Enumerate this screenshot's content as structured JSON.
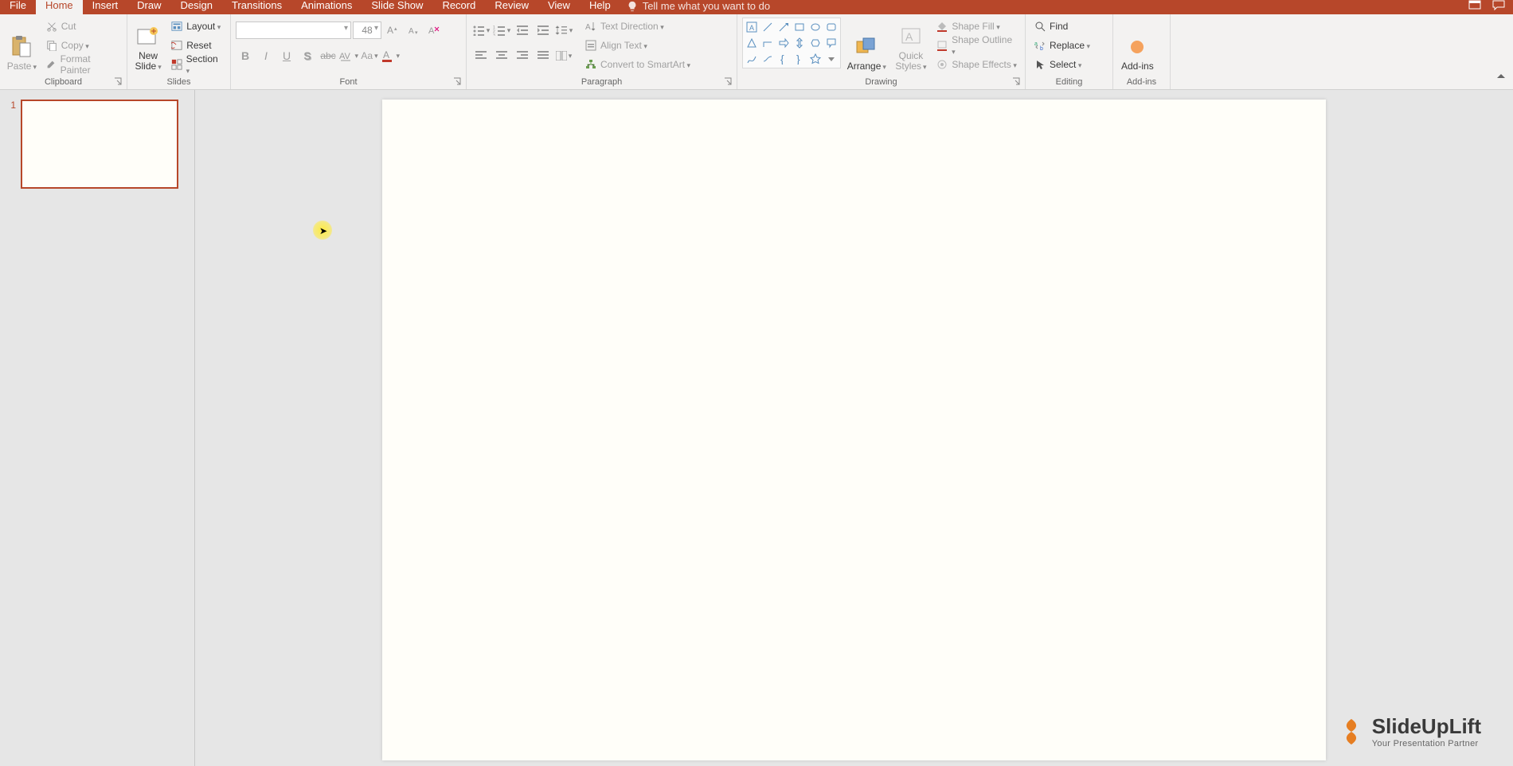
{
  "tabs": {
    "file": "File",
    "home": "Home",
    "insert": "Insert",
    "draw": "Draw",
    "design": "Design",
    "transitions": "Transitions",
    "animations": "Animations",
    "slideshow": "Slide Show",
    "record": "Record",
    "review": "Review",
    "view": "View",
    "help": "Help",
    "tellme": "Tell me what you want to do"
  },
  "clipboard": {
    "paste": "Paste",
    "cut": "Cut",
    "copy": "Copy",
    "format_painter": "Format Painter",
    "label": "Clipboard"
  },
  "slides": {
    "new_slide_l1": "New",
    "new_slide_l2": "Slide",
    "layout": "Layout",
    "reset": "Reset",
    "section": "Section",
    "label": "Slides"
  },
  "font": {
    "name_value": "",
    "size_value": "48",
    "label": "Font"
  },
  "paragraph": {
    "text_direction": "Text Direction",
    "align_text": "Align Text",
    "convert_smartart": "Convert to SmartArt",
    "label": "Paragraph"
  },
  "drawing": {
    "arrange": "Arrange",
    "quick_l1": "Quick",
    "quick_l2": "Styles",
    "shape_fill": "Shape Fill",
    "shape_outline": "Shape Outline",
    "shape_effects": "Shape Effects",
    "label": "Drawing"
  },
  "editing": {
    "find": "Find",
    "replace": "Replace",
    "select": "Select",
    "label": "Editing"
  },
  "addins": {
    "btn": "Add-ins",
    "label": "Add-ins"
  },
  "thumbs": {
    "n1": "1"
  },
  "watermark": {
    "brand": "SlideUpLift",
    "tag": "Your Presentation Partner"
  }
}
